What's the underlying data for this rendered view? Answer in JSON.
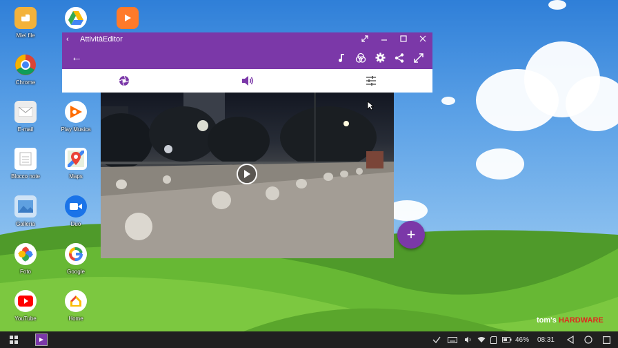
{
  "desktop": {
    "icons": [
      {
        "label": "Miei file"
      },
      {
        "label": "Chrome"
      },
      {
        "label": "E-mail"
      },
      {
        "label": "Blocco note"
      },
      {
        "label": "Galleria"
      },
      {
        "label": "Foto"
      },
      {
        "label": "YouTube"
      },
      {
        "label": "Drive"
      },
      {
        "label": "Play Musica"
      },
      {
        "label": "Maps"
      },
      {
        "label": "Duo"
      },
      {
        "label": "Google"
      },
      {
        "label": "Home"
      }
    ],
    "top_app_label": "VIDEOSHOW"
  },
  "window": {
    "title": "AttivitàEditor",
    "back_glyph": "‹",
    "arrow_glyph": "←",
    "colors": {
      "accent": "#7b38a8",
      "fab": "#7b38a8"
    }
  },
  "fab": {
    "label": "+"
  },
  "watermark": {
    "part1": "tom's",
    "part2": "HARDWARE"
  },
  "taskbar": {
    "battery": "46%",
    "time": "08:31"
  }
}
